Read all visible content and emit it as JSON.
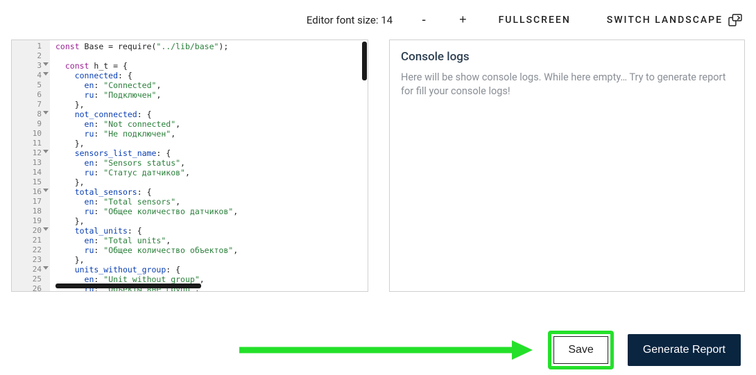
{
  "toolbar": {
    "font_size_label": "Editor font size: 14",
    "decrease": "-",
    "increase": "+",
    "fullscreen": "FULLSCREEN",
    "switch_landscape": "SWITCH LANDSCAPE"
  },
  "editor": {
    "gutter": [
      {
        "n": "1",
        "fold": false
      },
      {
        "n": "2",
        "fold": false
      },
      {
        "n": "3",
        "fold": true
      },
      {
        "n": "4",
        "fold": true
      },
      {
        "n": "5",
        "fold": false
      },
      {
        "n": "6",
        "fold": false
      },
      {
        "n": "7",
        "fold": false
      },
      {
        "n": "8",
        "fold": true
      },
      {
        "n": "9",
        "fold": false
      },
      {
        "n": "10",
        "fold": false
      },
      {
        "n": "11",
        "fold": false
      },
      {
        "n": "12",
        "fold": true
      },
      {
        "n": "13",
        "fold": false
      },
      {
        "n": "14",
        "fold": false
      },
      {
        "n": "15",
        "fold": false
      },
      {
        "n": "16",
        "fold": true
      },
      {
        "n": "17",
        "fold": false
      },
      {
        "n": "18",
        "fold": false
      },
      {
        "n": "19",
        "fold": false
      },
      {
        "n": "20",
        "fold": true
      },
      {
        "n": "21",
        "fold": false
      },
      {
        "n": "22",
        "fold": false
      },
      {
        "n": "23",
        "fold": false
      },
      {
        "n": "24",
        "fold": true
      },
      {
        "n": "25",
        "fold": false
      },
      {
        "n": "26",
        "fold": false
      }
    ],
    "lines": [
      [
        [
          "kw",
          "const"
        ],
        [
          "ident",
          " Base = require("
        ],
        [
          "str",
          "\"../lib/base\""
        ],
        [
          "punct",
          ");"
        ]
      ],
      [
        [
          "",
          ""
        ]
      ],
      [
        [
          "",
          "  "
        ],
        [
          "kw",
          "const"
        ],
        [
          "ident",
          " h_t = {"
        ]
      ],
      [
        [
          "",
          "    "
        ],
        [
          "prop",
          "connected"
        ],
        [
          "punct",
          ": {"
        ]
      ],
      [
        [
          "",
          "      "
        ],
        [
          "prop",
          "en"
        ],
        [
          "punct",
          ": "
        ],
        [
          "str",
          "\"Connected\""
        ],
        [
          "punct",
          ","
        ]
      ],
      [
        [
          "",
          "      "
        ],
        [
          "prop",
          "ru"
        ],
        [
          "punct",
          ": "
        ],
        [
          "str",
          "\"Подключен\""
        ],
        [
          "punct",
          ","
        ]
      ],
      [
        [
          "",
          "    "
        ],
        [
          "punct",
          "},"
        ]
      ],
      [
        [
          "",
          "    "
        ],
        [
          "prop",
          "not_connected"
        ],
        [
          "punct",
          ": {"
        ]
      ],
      [
        [
          "",
          "      "
        ],
        [
          "prop",
          "en"
        ],
        [
          "punct",
          ": "
        ],
        [
          "str",
          "\"Not connected\""
        ],
        [
          "punct",
          ","
        ]
      ],
      [
        [
          "",
          "      "
        ],
        [
          "prop",
          "ru"
        ],
        [
          "punct",
          ": "
        ],
        [
          "str",
          "\"Не подключен\""
        ],
        [
          "punct",
          ","
        ]
      ],
      [
        [
          "",
          "    "
        ],
        [
          "punct",
          "},"
        ]
      ],
      [
        [
          "",
          "    "
        ],
        [
          "prop",
          "sensors_list_name"
        ],
        [
          "punct",
          ": {"
        ]
      ],
      [
        [
          "",
          "      "
        ],
        [
          "prop",
          "en"
        ],
        [
          "punct",
          ": "
        ],
        [
          "str",
          "\"Sensors status\""
        ],
        [
          "punct",
          ","
        ]
      ],
      [
        [
          "",
          "      "
        ],
        [
          "prop",
          "ru"
        ],
        [
          "punct",
          ": "
        ],
        [
          "str",
          "\"Статус датчиков\""
        ],
        [
          "punct",
          ","
        ]
      ],
      [
        [
          "",
          "    "
        ],
        [
          "punct",
          "},"
        ]
      ],
      [
        [
          "",
          "    "
        ],
        [
          "prop",
          "total_sensors"
        ],
        [
          "punct",
          ": {"
        ]
      ],
      [
        [
          "",
          "      "
        ],
        [
          "prop",
          "en"
        ],
        [
          "punct",
          ": "
        ],
        [
          "str",
          "\"Total sensors\""
        ],
        [
          "punct",
          ","
        ]
      ],
      [
        [
          "",
          "      "
        ],
        [
          "prop",
          "ru"
        ],
        [
          "punct",
          ": "
        ],
        [
          "str",
          "\"Общее количество датчиков\""
        ],
        [
          "punct",
          ","
        ]
      ],
      [
        [
          "",
          "    "
        ],
        [
          "punct",
          "},"
        ]
      ],
      [
        [
          "",
          "    "
        ],
        [
          "prop",
          "total_units"
        ],
        [
          "punct",
          ": {"
        ]
      ],
      [
        [
          "",
          "      "
        ],
        [
          "prop",
          "en"
        ],
        [
          "punct",
          ": "
        ],
        [
          "str",
          "\"Total units\""
        ],
        [
          "punct",
          ","
        ]
      ],
      [
        [
          "",
          "      "
        ],
        [
          "prop",
          "ru"
        ],
        [
          "punct",
          ": "
        ],
        [
          "str",
          "\"Общее количество объектов\""
        ],
        [
          "punct",
          ","
        ]
      ],
      [
        [
          "",
          "    "
        ],
        [
          "punct",
          "},"
        ]
      ],
      [
        [
          "",
          "    "
        ],
        [
          "prop",
          "units_without_group"
        ],
        [
          "punct",
          ": {"
        ]
      ],
      [
        [
          "",
          "      "
        ],
        [
          "prop",
          "en"
        ],
        [
          "punct",
          ": "
        ],
        [
          "str",
          "\"Unit without group\""
        ],
        [
          "punct",
          ","
        ]
      ],
      [
        [
          "",
          "      "
        ],
        [
          "prop",
          "ru"
        ],
        [
          "punct",
          ": "
        ],
        [
          "str",
          "\"Объекты вне групп\""
        ],
        [
          "punct",
          ","
        ]
      ]
    ]
  },
  "console": {
    "title": "Console logs",
    "placeholder": "Here will be show console logs. While here empty… Try to generate report for fill your console logs!"
  },
  "footer": {
    "save": "Save",
    "generate": "Generate Report"
  }
}
